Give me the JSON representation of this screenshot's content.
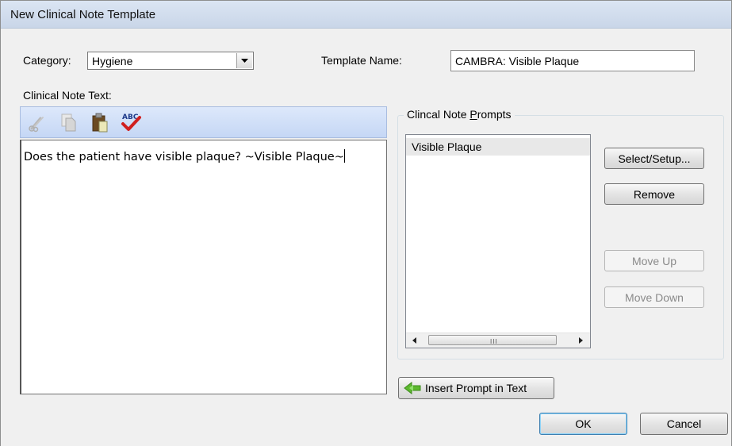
{
  "window": {
    "title": "New Clinical Note Template"
  },
  "category": {
    "label": "Category:",
    "value": "Hygiene"
  },
  "template_name": {
    "label": "Template Name:",
    "value": "CAMBRA: Visible Plaque"
  },
  "note_text": {
    "label": "Clinical Note Text:",
    "toolbar": {
      "icons": [
        "cut-icon",
        "copy-icon",
        "paste-icon",
        "spellcheck-icon"
      ],
      "spellcheck_text": "ABC"
    },
    "content": "Does the patient have visible plaque? ~Visible Plaque~"
  },
  "prompts": {
    "group_label": "Clincal Note Prompts",
    "items": [
      "Visible Plaque"
    ],
    "scroll_grip": "III"
  },
  "buttons": {
    "select_setup": "Select/Setup...",
    "remove": "Remove",
    "move_up": "Move Up",
    "move_down": "Move Down",
    "insert_prompt": "Insert Prompt in Text",
    "ok": "OK",
    "cancel": "Cancel"
  },
  "colors": {
    "titlebar": "#c9d6e8",
    "toolbar": "#c5d7f5",
    "insert_arrow": "#5cb82e"
  }
}
